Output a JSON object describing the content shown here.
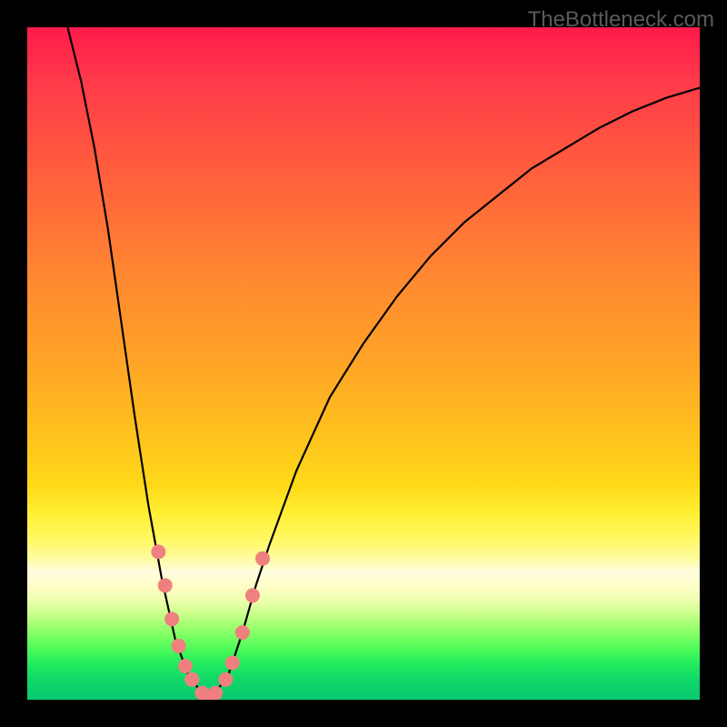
{
  "watermark": "TheBottleneck.com",
  "chart_data": {
    "type": "line",
    "title": "",
    "xlabel": "",
    "ylabel": "",
    "xlim": [
      0,
      100
    ],
    "ylim": [
      0,
      100
    ],
    "curve_points": [
      {
        "x": 6,
        "y": 100
      },
      {
        "x": 8,
        "y": 92
      },
      {
        "x": 10,
        "y": 82
      },
      {
        "x": 12,
        "y": 70
      },
      {
        "x": 14,
        "y": 56
      },
      {
        "x": 16,
        "y": 42
      },
      {
        "x": 18,
        "y": 29
      },
      {
        "x": 20,
        "y": 18
      },
      {
        "x": 22,
        "y": 9
      },
      {
        "x": 24,
        "y": 3.5
      },
      {
        "x": 26,
        "y": 1
      },
      {
        "x": 27,
        "y": 0.5
      },
      {
        "x": 28,
        "y": 1
      },
      {
        "x": 30,
        "y": 4
      },
      {
        "x": 32,
        "y": 10
      },
      {
        "x": 34,
        "y": 17
      },
      {
        "x": 36,
        "y": 23
      },
      {
        "x": 40,
        "y": 34
      },
      {
        "x": 45,
        "y": 45
      },
      {
        "x": 50,
        "y": 53
      },
      {
        "x": 55,
        "y": 60
      },
      {
        "x": 60,
        "y": 66
      },
      {
        "x": 65,
        "y": 71
      },
      {
        "x": 70,
        "y": 75
      },
      {
        "x": 75,
        "y": 79
      },
      {
        "x": 80,
        "y": 82
      },
      {
        "x": 85,
        "y": 85
      },
      {
        "x": 90,
        "y": 87.5
      },
      {
        "x": 95,
        "y": 89.5
      },
      {
        "x": 100,
        "y": 91
      }
    ],
    "markers": [
      {
        "x": 19.5,
        "y": 22
      },
      {
        "x": 20.5,
        "y": 17
      },
      {
        "x": 21.5,
        "y": 12
      },
      {
        "x": 22.5,
        "y": 8
      },
      {
        "x": 23.5,
        "y": 5
      },
      {
        "x": 24.5,
        "y": 3
      },
      {
        "x": 26,
        "y": 1
      },
      {
        "x": 27,
        "y": 0.5
      },
      {
        "x": 28,
        "y": 1
      },
      {
        "x": 29.5,
        "y": 3
      },
      {
        "x": 30.5,
        "y": 5.5
      },
      {
        "x": 32,
        "y": 10
      },
      {
        "x": 33.5,
        "y": 15.5
      },
      {
        "x": 35,
        "y": 21
      }
    ],
    "marker_color": "#f08080",
    "marker_radius": 8
  },
  "colors": {
    "background": "#000000",
    "curve": "#000000",
    "marker": "#f08080",
    "watermark": "#5a5a5a"
  }
}
